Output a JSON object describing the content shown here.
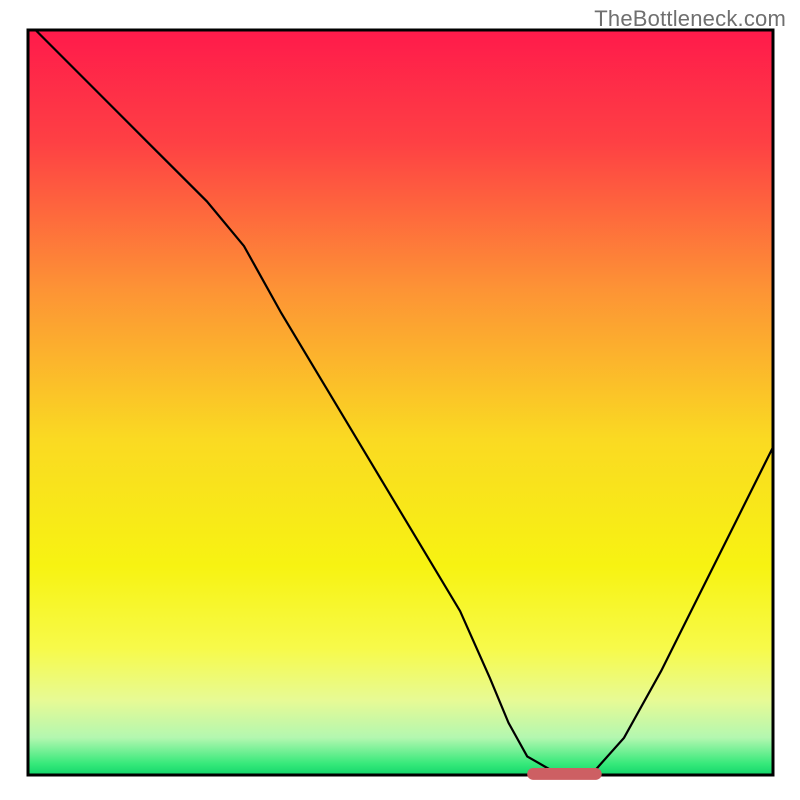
{
  "watermark": "TheBottleneck.com",
  "chart_data": {
    "type": "line",
    "title": "",
    "xlabel": "",
    "ylabel": "",
    "xlim": [
      0,
      100
    ],
    "ylim": [
      0,
      100
    ],
    "grid": false,
    "legend": false,
    "background": {
      "type": "vertical-gradient",
      "stops": [
        {
          "pos": 0.0,
          "color": "#ff1a4b"
        },
        {
          "pos": 0.15,
          "color": "#fe4044"
        },
        {
          "pos": 0.35,
          "color": "#fd9435"
        },
        {
          "pos": 0.55,
          "color": "#fada22"
        },
        {
          "pos": 0.72,
          "color": "#f7f312"
        },
        {
          "pos": 0.83,
          "color": "#f7fa4a"
        },
        {
          "pos": 0.9,
          "color": "#e7fa95"
        },
        {
          "pos": 0.95,
          "color": "#b3f7b0"
        },
        {
          "pos": 0.985,
          "color": "#36e97a"
        },
        {
          "pos": 1.0,
          "color": "#12d66b"
        }
      ]
    },
    "series": [
      {
        "name": "bottleneck-curve",
        "color": "#000000",
        "width": 2.2,
        "x": [
          1,
          8,
          16,
          24,
          29,
          34,
          40,
          46,
          52,
          58,
          62,
          64.5,
          67,
          71,
          73,
          76,
          80,
          85,
          90,
          95,
          100
        ],
        "y": [
          100,
          93,
          85,
          77,
          71,
          62,
          52,
          42,
          32,
          22,
          13,
          7,
          2.5,
          0.2,
          0,
          0.5,
          5,
          14,
          24,
          34,
          44
        ]
      }
    ],
    "marker": {
      "name": "optimal-range",
      "shape": "rounded-bar",
      "color": "#cd5f63",
      "x_start": 67,
      "x_end": 77,
      "y": 0,
      "height_pct": 1.6
    },
    "axes": {
      "ticks_visible": false,
      "labels_visible": false,
      "frame_color": "#000000",
      "frame_width": 3
    }
  }
}
